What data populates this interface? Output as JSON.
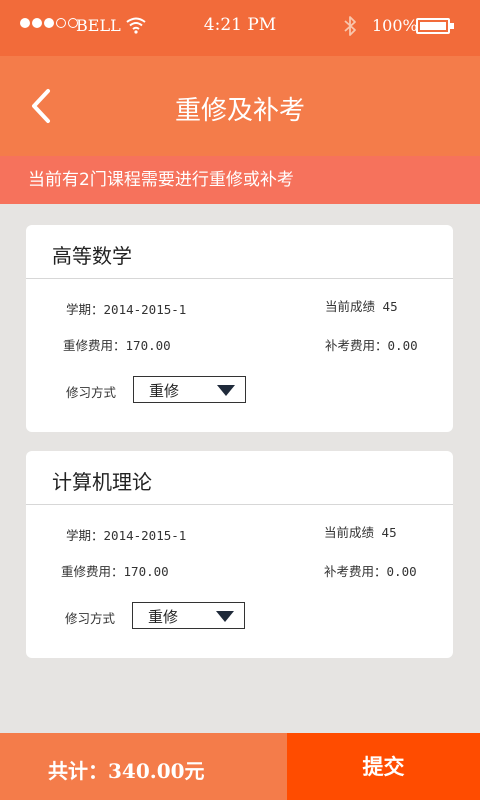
{
  "status_bar": {
    "carrier": "BELL",
    "time": "4:21 PM",
    "battery": "100%",
    "signal_icon": "signal-dots-icon",
    "wifi_icon": "wifi-icon",
    "bluetooth_icon": "bluetooth-icon",
    "battery_icon": "battery-icon"
  },
  "nav": {
    "title": "重修及补考",
    "back_icon": "back-arrow-icon"
  },
  "notice": "当前有2门课程需要进行重修或补考",
  "courses": [
    {
      "title": "高等数学",
      "term_label": "学期：",
      "term": "2014-2015-1",
      "score_label": "当前成绩",
      "score": "45",
      "retake_fee_label": "重修费用：",
      "retake_fee": "170.00",
      "makeup_fee_label": "补考费用：",
      "makeup_fee": "0.00",
      "method_label": "修习方式",
      "method": "重修"
    },
    {
      "title": "计算机理论",
      "term_label": "学期：",
      "term": "2014-2015-1",
      "score_label": "当前成绩",
      "score": "45",
      "retake_fee_label": "重修费用：",
      "retake_fee": "170.00",
      "makeup_fee_label": "补考费用：",
      "makeup_fee": "0.00",
      "method_label": "修习方式",
      "method": "重修"
    }
  ],
  "footer": {
    "total_label": "共计：",
    "total": "340.00",
    "currency": "元",
    "submit_label": "提交"
  },
  "colors": {
    "status_bar": "#f26b3a",
    "nav_bar": "#f47c4a",
    "notice_bar": "#f6725c",
    "background": "#e6e4e2",
    "submit": "#ff4c00"
  }
}
